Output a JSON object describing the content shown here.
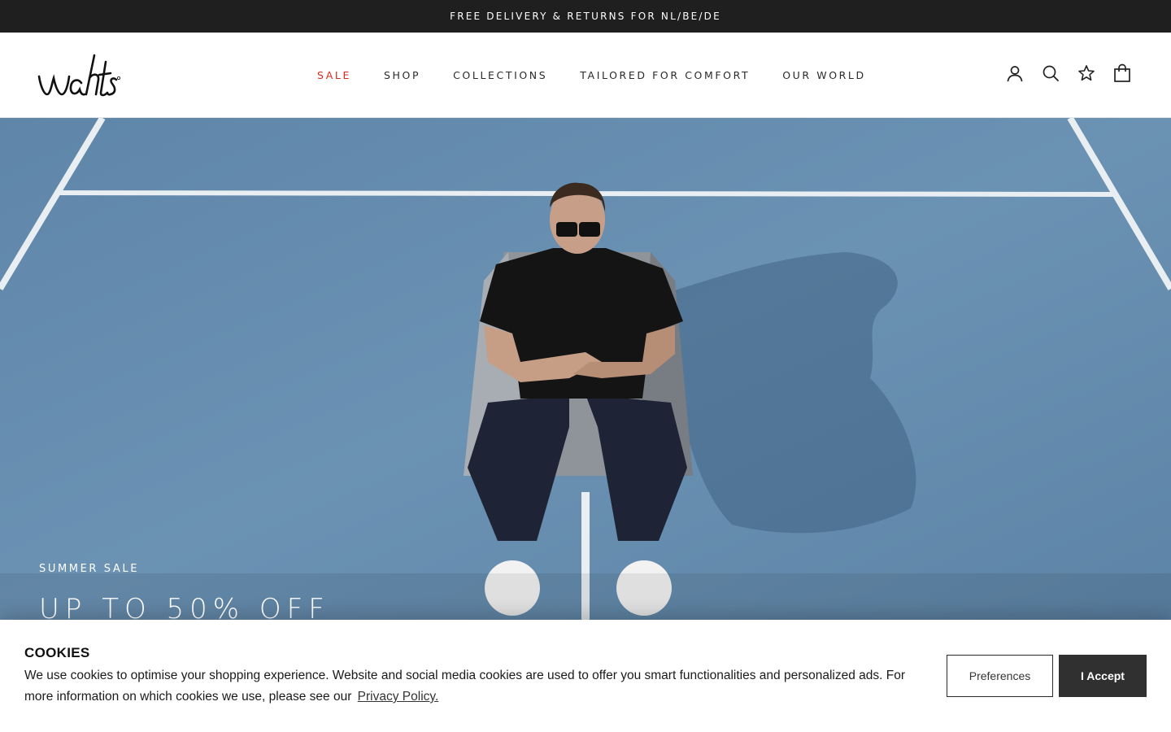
{
  "announcement": {
    "text": "FREE DELIVERY & RETURNS FOR NL/BE/DE"
  },
  "header": {
    "logo_text": "wahts",
    "nav": [
      {
        "label": "SALE",
        "highlight_color": "#d62b1f"
      },
      {
        "label": "SHOP"
      },
      {
        "label": "COLLECTIONS"
      },
      {
        "label": "TAILORED FOR COMFORT"
      },
      {
        "label": "OUR WORLD"
      }
    ],
    "icons": [
      "account-icon",
      "search-icon",
      "wishlist-star-icon",
      "cart-bag-icon"
    ]
  },
  "hero": {
    "eyebrow": "SUMMER SALE",
    "title": "UP TO 50% OFF",
    "background_color": "#6a8fb0"
  },
  "cookie_banner": {
    "title": "COOKIES",
    "text": "We use cookies to optimise your shopping experience. Website and social media cookies are used to offer you smart functionalities and personalized ads. For more information on which cookies we use, please see our",
    "link_label": "Privacy Policy.",
    "preferences_label": "Preferences",
    "accept_label": "I Accept"
  }
}
